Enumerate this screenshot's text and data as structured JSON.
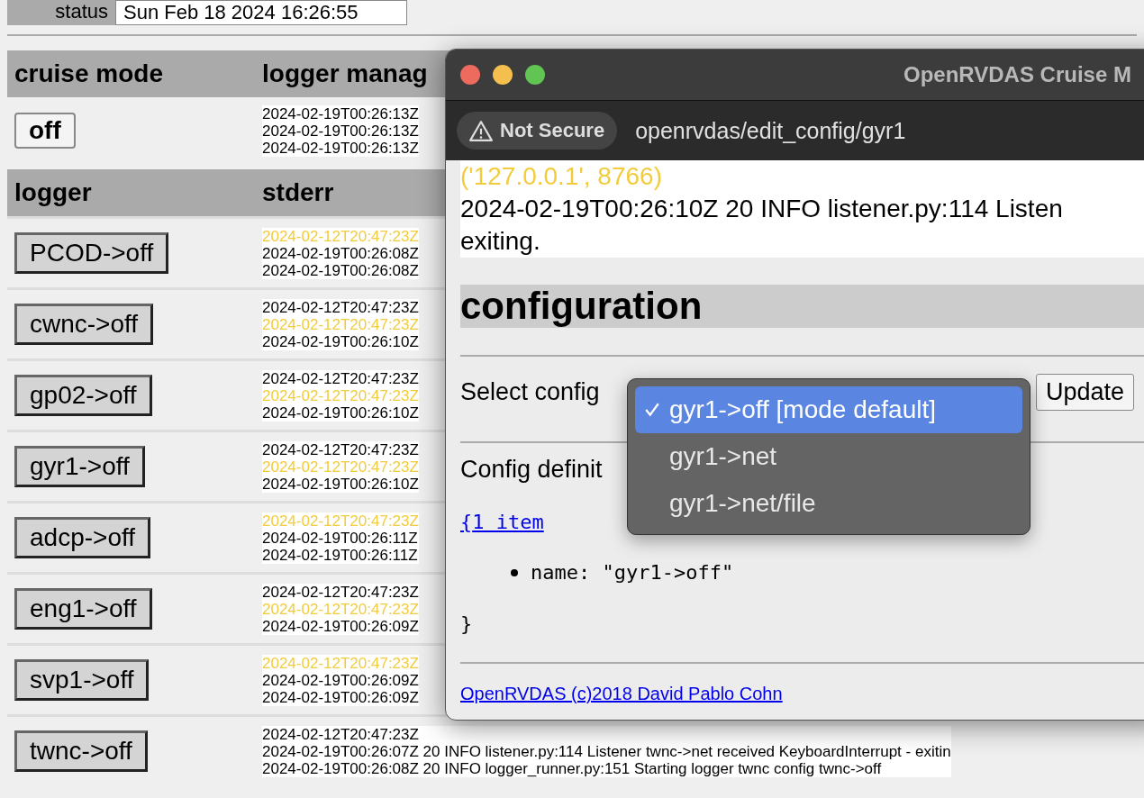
{
  "status": {
    "label": "status",
    "value": "Sun Feb 18 2024 16:26:55"
  },
  "cruise_table": {
    "columns": [
      "cruise mode",
      "logger manag"
    ],
    "mode_button": "off",
    "log_lines": [
      {
        "text": "2024-02-19T00:26:13Z",
        "color": "#000000"
      },
      {
        "text": "2024-02-19T00:26:13Z",
        "color": "#000000"
      },
      {
        "text": "2024-02-19T00:26:13Z",
        "color": "#000000"
      }
    ]
  },
  "logger_table": {
    "columns": [
      "logger",
      "stderr"
    ],
    "rows": [
      {
        "button": "PCOD->off",
        "log_lines": [
          {
            "text": "2024-02-12T20:47:23Z",
            "color": "#f2cc3c"
          },
          {
            "text": "2024-02-19T00:26:08Z",
            "color": "#000000"
          },
          {
            "text": "2024-02-19T00:26:08Z",
            "color": "#000000"
          }
        ]
      },
      {
        "button": "cwnc->off",
        "log_lines": [
          {
            "text": "2024-02-12T20:47:23Z",
            "color": "#000000"
          },
          {
            "text": "2024-02-12T20:47:23Z",
            "color": "#f2cc3c"
          },
          {
            "text": "2024-02-19T00:26:10Z",
            "color": "#000000"
          }
        ]
      },
      {
        "button": "gp02->off",
        "log_lines": [
          {
            "text": "2024-02-12T20:47:23Z",
            "color": "#000000"
          },
          {
            "text": "2024-02-12T20:47:23Z",
            "color": "#f2cc3c"
          },
          {
            "text": "2024-02-19T00:26:10Z",
            "color": "#000000"
          }
        ]
      },
      {
        "button": "gyr1->off",
        "log_lines": [
          {
            "text": "2024-02-12T20:47:23Z",
            "color": "#000000"
          },
          {
            "text": "2024-02-12T20:47:23Z",
            "color": "#f2cc3c"
          },
          {
            "text": "2024-02-19T00:26:10Z",
            "color": "#000000"
          }
        ]
      },
      {
        "button": "adcp->off",
        "log_lines": [
          {
            "text": "2024-02-12T20:47:23Z",
            "color": "#f2cc3c"
          },
          {
            "text": "2024-02-19T00:26:11Z",
            "color": "#000000"
          },
          {
            "text": "2024-02-19T00:26:11Z",
            "color": "#000000"
          }
        ]
      },
      {
        "button": "eng1->off",
        "log_lines": [
          {
            "text": "2024-02-12T20:47:23Z",
            "color": "#000000"
          },
          {
            "text": "2024-02-12T20:47:23Z",
            "color": "#f2cc3c"
          },
          {
            "text": "2024-02-19T00:26:09Z",
            "color": "#000000"
          }
        ]
      },
      {
        "button": "svp1->off",
        "log_lines": [
          {
            "text": "2024-02-12T20:47:23Z",
            "color": "#f2cc3c"
          },
          {
            "text": "2024-02-19T00:26:09Z",
            "color": "#000000"
          },
          {
            "text": "2024-02-19T00:26:09Z",
            "color": "#000000"
          }
        ]
      },
      {
        "button": "twnc->off",
        "log_lines": [
          {
            "text": "2024-02-12T20:47:23Z",
            "color": "#000000"
          },
          {
            "text": "2024-02-19T00:26:07Z 20 INFO listener.py:114 Listener twnc->net received KeyboardInterrupt - exitin",
            "color": "#000000"
          },
          {
            "text": "2024-02-19T00:26:08Z 20 INFO logger_runner.py:151 Starting logger twnc config twnc->off",
            "color": "#000000"
          }
        ]
      }
    ]
  },
  "window": {
    "title": "OpenRVDAS Cruise M",
    "security_label": "Not Secure",
    "url": "openrvdas/edit_config/gyr1",
    "log_lines": [
      {
        "text": "('127.0.0.1', 8766)",
        "color": "#f2cc3c"
      },
      {
        "text": "2024-02-19T00:26:10Z 20 INFO listener.py:114 Listen",
        "color": "#000000"
      },
      {
        "text": "exiting.",
        "color": "#000000"
      }
    ],
    "heading": "configuration",
    "select_label": "Select config",
    "update_button": "Update",
    "config_label": "Config definit",
    "brace_open": "{",
    "item_count": "1 item",
    "items": [
      "name: \"gyr1->off\""
    ],
    "brace_close": "}",
    "footer_link": "OpenRVDAS (c)2018 David Pablo Cohn",
    "dropdown": {
      "options": [
        {
          "label": "gyr1->off [mode default]",
          "selected": true
        },
        {
          "label": "gyr1->net",
          "selected": false
        },
        {
          "label": "gyr1->net/file",
          "selected": false
        }
      ]
    }
  }
}
